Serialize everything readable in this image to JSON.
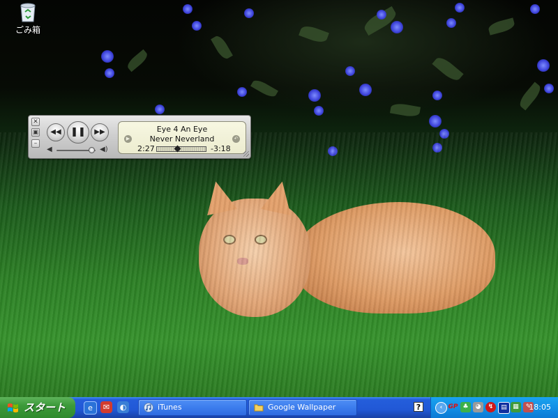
{
  "desktop": {
    "recycle_bin_label": "ごみ箱"
  },
  "mini_player": {
    "track_title": "Eye 4 An Eye",
    "artist": "Never Neverland",
    "elapsed": "2:27",
    "remaining": "-3:18",
    "progress_fraction": 0.43,
    "volume_fraction": 0.9,
    "controls": {
      "previous_icon": "rewind-icon",
      "play_pause_icon": "pause-icon",
      "next_icon": "fast-forward-icon"
    },
    "window_buttons": [
      "close-icon",
      "restore-icon",
      "minimize-icon"
    ]
  },
  "taskbar": {
    "start_label": "スタート",
    "quick_launch": [
      "ie-icon",
      "outlook-express-icon",
      "show-desktop-icon"
    ],
    "tasks": [
      {
        "label": "iTunes",
        "icon": "itunes-icon",
        "active": false
      },
      {
        "label": "Google Wallpaper",
        "icon": "folder-icon",
        "active": false
      }
    ],
    "help_label": "?",
    "tray_icons": [
      "chevron-left-icon",
      "antivirus-icon",
      "network-icon",
      "speaker-icon",
      "mcafee-icon",
      "monitor-icon",
      "display-icon",
      "ime-icon"
    ],
    "clock": "18:05"
  },
  "colors": {
    "taskbar_blue": "#245edb",
    "start_green": "#3c9a3a",
    "tray_blue": "#1290e6",
    "lcd_background": "#f0f0d6"
  }
}
